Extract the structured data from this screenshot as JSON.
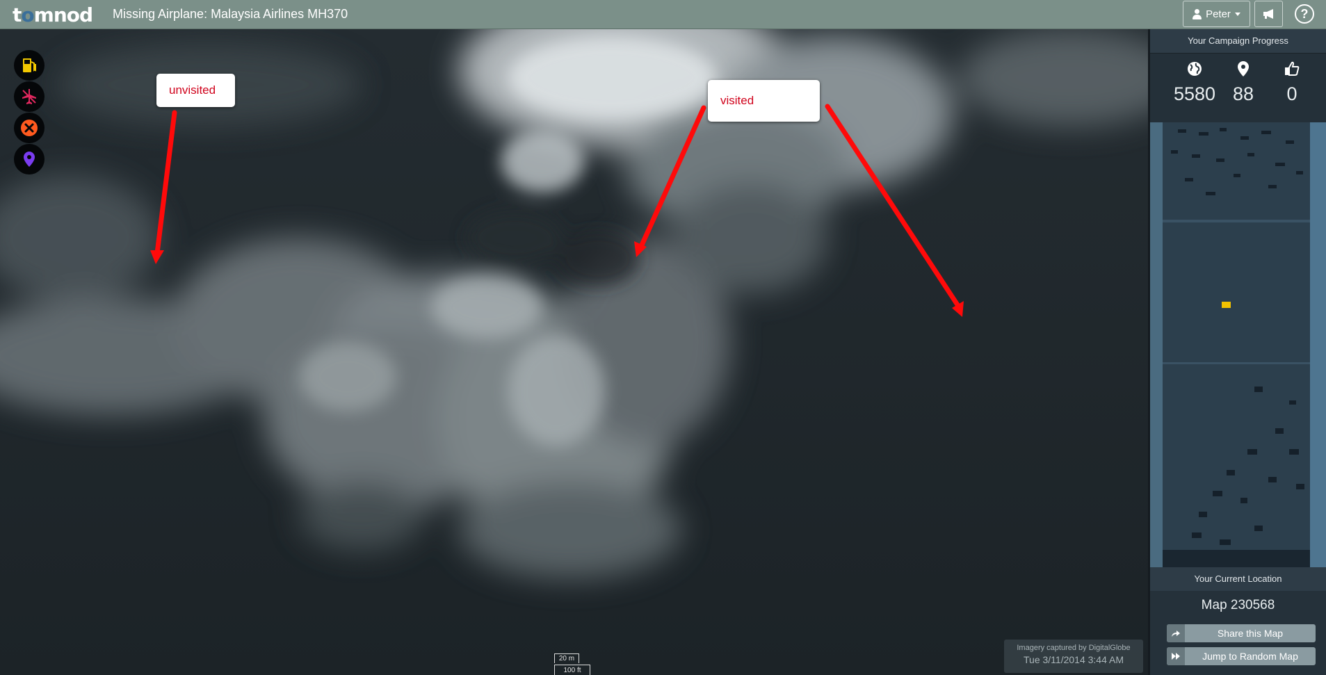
{
  "header": {
    "logo": {
      "pre": "t",
      "dot": "o",
      "post": "mnod"
    },
    "title": "Missing Airplane: Malaysia Airlines MH370",
    "user_label": "Peter",
    "help_label": "?"
  },
  "tools": [
    {
      "name": "fuel-icon",
      "color": "#f2c800"
    },
    {
      "name": "airplane-icon",
      "color": "#e2285f"
    },
    {
      "name": "close-circle-icon",
      "color": "#ff5a1f"
    },
    {
      "name": "map-pin-icon",
      "color": "#7a3cf0"
    }
  ],
  "annotations": {
    "unvisited": "unvisited",
    "visited": "visited"
  },
  "attribution": {
    "source": "Imagery captured by DigitalGlobe",
    "date": "Tue 3/11/2014 3:44 AM"
  },
  "scale": {
    "metric": "20 m",
    "imperial": "100 ft"
  },
  "panel": {
    "progress_header": "Your Campaign Progress",
    "stats": [
      {
        "icon": "globe-icon",
        "value": "5580"
      },
      {
        "icon": "map-marker-icon",
        "value": "88"
      },
      {
        "icon": "thumbs-up-icon",
        "value": "0"
      }
    ],
    "location_header": "Your Current Location",
    "map_id": "Map 230568",
    "share_label": "Share this Map",
    "jump_label": "Jump to Random Map"
  },
  "colors": {
    "topbar": "#7b9089",
    "callout_text": "#d0021b",
    "arrow": "#ff0a0a",
    "minimap_marker": "#f2c200"
  }
}
